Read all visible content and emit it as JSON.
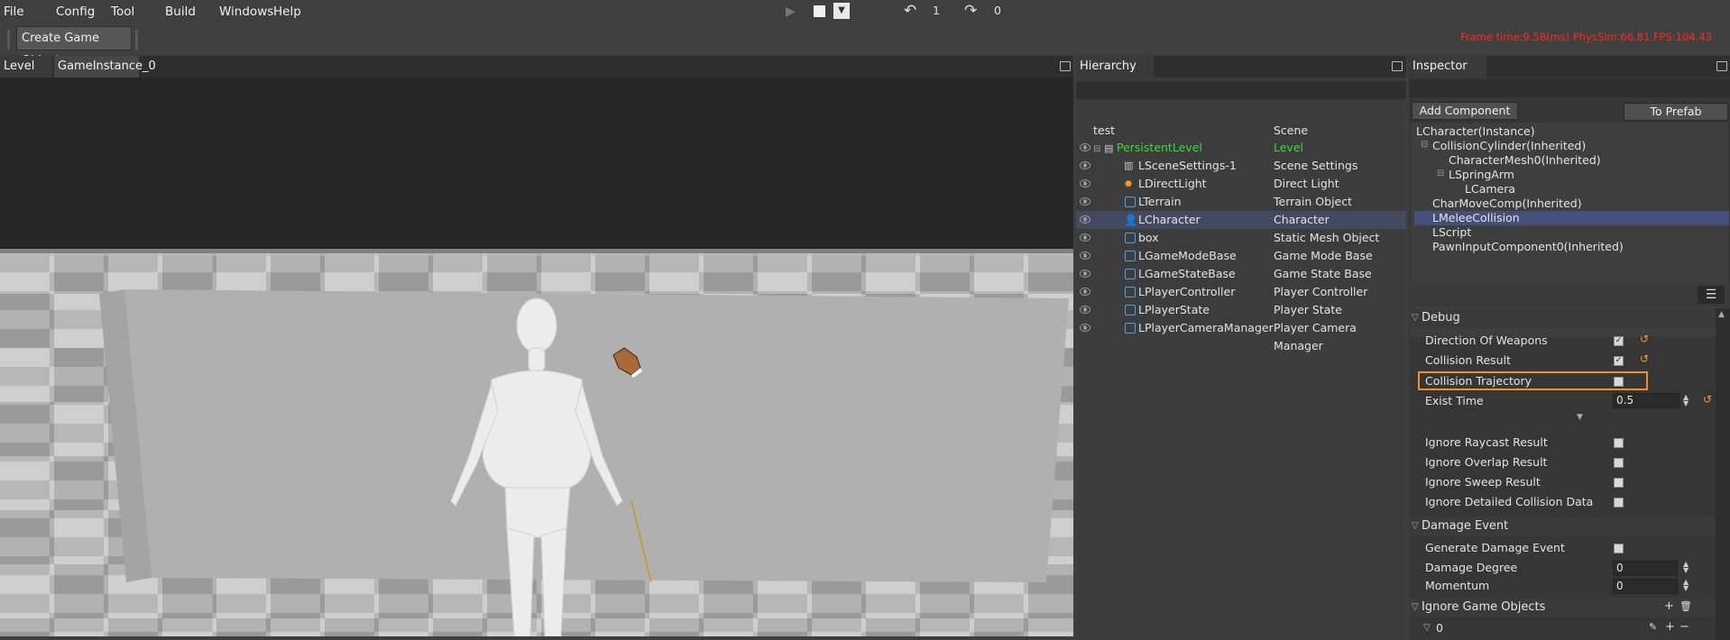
{
  "menubar": {
    "items": [
      "File",
      "Config",
      "Tool",
      "Build",
      "Windows",
      "Help"
    ],
    "undo_count": "1",
    "redo_count": "0"
  },
  "toolbar": {
    "create_game_object": "Create Game Object",
    "stats": "Frame time:9.58(ms)   PhysSim:66.81   FPS:104.43"
  },
  "viewport": {
    "tabs": [
      "Level",
      "GameInstance_0"
    ]
  },
  "hierarchy": {
    "title": "Hierarchy",
    "col_name": "test",
    "col_type": "Scene",
    "rows": [
      {
        "name": "PersistentLevel",
        "type": "Level",
        "icon": "level-icon"
      },
      {
        "name": "LSceneSettings-1",
        "type": "Scene Settings",
        "icon": "settings-icon"
      },
      {
        "name": "LDirectLight",
        "type": "Direct Light",
        "icon": "sun-icon"
      },
      {
        "name": "LTerrain",
        "type": "Terrain Object",
        "icon": "cube-icon"
      },
      {
        "name": "LCharacter",
        "type": "Character",
        "icon": "person-icon"
      },
      {
        "name": "box",
        "type": "Static Mesh Object",
        "icon": "cube-icon"
      },
      {
        "name": "LGameModeBase",
        "type": "Game Mode Base",
        "icon": "cube-icon"
      },
      {
        "name": "LGameStateBase",
        "type": "Game State Base",
        "icon": "cube-icon"
      },
      {
        "name": "LPlayerController",
        "type": "Player Controller",
        "icon": "cube-icon"
      },
      {
        "name": "LPlayerState",
        "type": "Player State",
        "icon": "cube-icon"
      },
      {
        "name": "LPlayerCameraManager",
        "type": "Player Camera Manager",
        "icon": "cube-icon"
      }
    ]
  },
  "inspector": {
    "title": "Inspector",
    "add_component": "Add Component",
    "to_prefab": "To Prefab",
    "components": [
      "LCharacter(Instance)",
      "CollisionCylinder(Inherited)",
      "CharacterMesh0(Inherited)",
      "LSpringArm",
      "LCamera",
      "CharMoveComp(Inherited)",
      "LMeleeCollision",
      "LScript",
      "PawnInputComponent0(Inherited)"
    ],
    "debug": {
      "title": "Debug",
      "direction_of_weapons": "Direction Of Weapons",
      "collision_result": "Collision Result",
      "collision_trajectory": "Collision Trajectory",
      "exist_time": "Exist Time",
      "exist_time_value": "0.5",
      "ignore_raycast": "Ignore Raycast Result",
      "ignore_overlap": "Ignore Overlap Result",
      "ignore_sweep": "Ignore Sweep Result",
      "ignore_detailed": "Ignore Detailed Collision Data"
    },
    "damage": {
      "title": "Damage Event",
      "generate": "Generate Damage Event",
      "degree": "Damage Degree",
      "degree_value": "0",
      "momentum": "Momentum",
      "momentum_value": "0"
    },
    "ignore_objects": {
      "title": "Ignore Game Objects",
      "item0": "0"
    }
  },
  "colors": {
    "accent_green": "#3ddc3d",
    "stats_red": "#ff2a1f",
    "highlight_orange": "#f0902a",
    "selection_blue": "#44507a"
  }
}
